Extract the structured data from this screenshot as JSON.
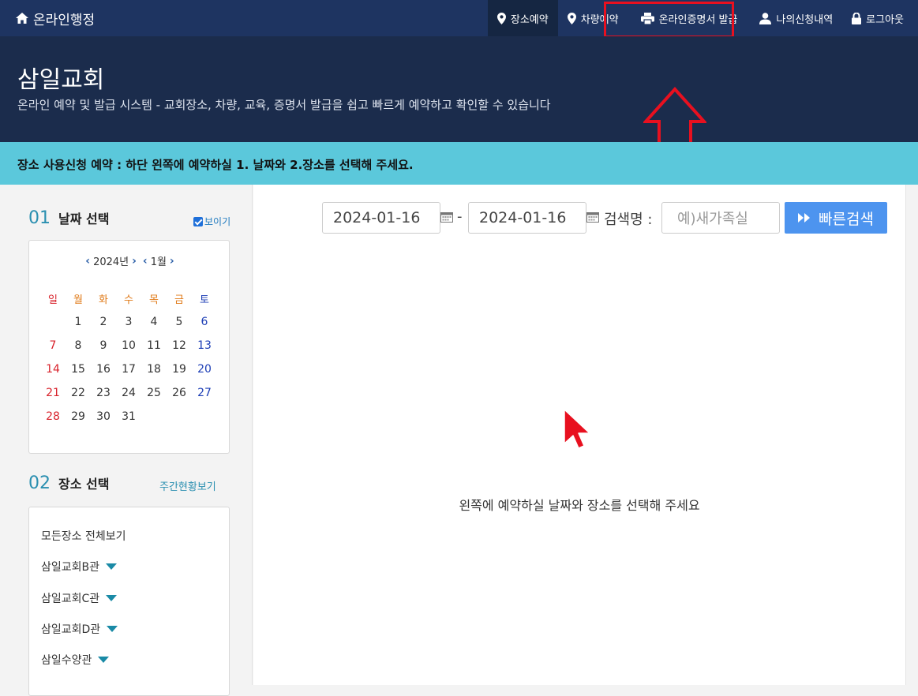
{
  "navbar": {
    "brand": "온라인행정",
    "items": [
      {
        "label": "장소예약",
        "icon": "map-pin-icon",
        "active": true
      },
      {
        "label": "차량예약",
        "icon": "map-pin-icon",
        "active": false
      },
      {
        "label": "온라인증명서 발급",
        "icon": "printer-icon",
        "active": false
      },
      {
        "label": "나의신청내역",
        "icon": "user-icon",
        "active": false
      },
      {
        "label": "로그아웃",
        "icon": "lock-icon",
        "active": false
      }
    ]
  },
  "hero": {
    "title": "삼일교회",
    "subtitle": "온라인 예약 및 발급 시스템 - 교회장소, 차량, 교육, 증명서 발급을 쉽고 빠르게 예약하고 확인할 수 있습니다"
  },
  "notice": "장소 사용신청 예약 : 하단 왼쪽에 예약하실 1. 날짜와 2.장소를 선택해 주세요.",
  "date_section": {
    "number": "01",
    "title": "날짜 선택",
    "show_label": "보이기",
    "year_label": "2024년",
    "month_label": "1월",
    "weekdays": [
      "일",
      "월",
      "화",
      "수",
      "목",
      "금",
      "토"
    ],
    "weeks": [
      [
        "",
        "1",
        "2",
        "3",
        "4",
        "5",
        "6"
      ],
      [
        "7",
        "8",
        "9",
        "10",
        "11",
        "12",
        "13"
      ],
      [
        "14",
        "15",
        "16",
        "17",
        "18",
        "19",
        "20"
      ],
      [
        "21",
        "22",
        "23",
        "24",
        "25",
        "26",
        "27"
      ],
      [
        "28",
        "29",
        "30",
        "31",
        "",
        "",
        ""
      ]
    ]
  },
  "place_section": {
    "number": "02",
    "title": "장소 선택",
    "weekly_link": "주간현황보기",
    "items": [
      "모든장소 전체보기",
      "삼일교회B관",
      "삼일교회C관",
      "삼일교회D관",
      "삼일수양관"
    ]
  },
  "search": {
    "start_date": "2024-01-16",
    "separator": "-",
    "end_date": "2024-01-16",
    "name_label": "검색명 :",
    "name_placeholder": "예)새가족실",
    "button_label": "빠른검색"
  },
  "main": {
    "empty_message": "왼쪽에 예약하실 날짜와 장소를 선택해 주세요"
  },
  "colors": {
    "navbar": "#1e3461",
    "hero": "#1b2c4c",
    "notice": "#5bc8db",
    "accent": "#4d94ef",
    "highlight": "#e8101f"
  }
}
